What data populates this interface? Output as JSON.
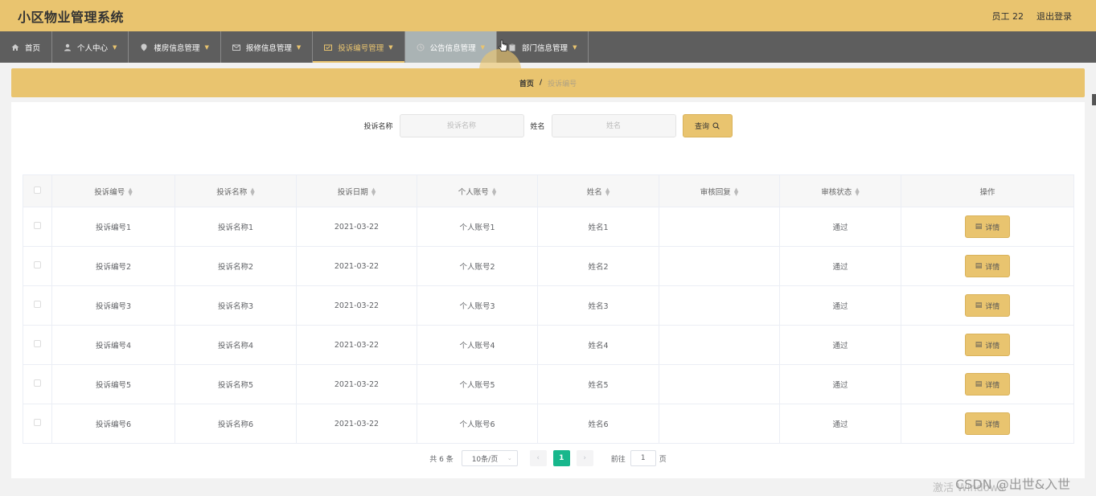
{
  "header": {
    "title": "小区物业管理系统",
    "user": "员工 22",
    "logout": "退出登录"
  },
  "nav": {
    "items": [
      {
        "label": "首页",
        "icon": "home-icon",
        "has_caret": false
      },
      {
        "label": "个人中心",
        "icon": "person-icon",
        "has_caret": true
      },
      {
        "label": "楼房信息管理",
        "icon": "location-icon",
        "has_caret": true
      },
      {
        "label": "报修信息管理",
        "icon": "mail-icon",
        "has_caret": true
      },
      {
        "label": "投诉编号管理",
        "icon": "ticket-icon",
        "has_caret": true,
        "active": true
      },
      {
        "label": "公告信息管理",
        "icon": "clock-icon",
        "has_caret": true,
        "hovered": true
      },
      {
        "label": "部门信息管理",
        "icon": "clipboard-icon",
        "has_caret": true
      }
    ],
    "caret": "▼"
  },
  "breadcrumb": {
    "home": "首页",
    "separator": "/",
    "current": "投诉编号"
  },
  "search": {
    "name_label": "投诉名称",
    "name_placeholder": "投诉名称",
    "person_label": "姓名",
    "person_placeholder": "姓名",
    "query_label": "查询"
  },
  "table": {
    "columns": [
      "投诉编号",
      "投诉名称",
      "投诉日期",
      "个人账号",
      "姓名",
      "审核回复",
      "审核状态",
      "操作"
    ],
    "rows": [
      {
        "code": "投诉编号1",
        "name": "投诉名称1",
        "date": "2021-03-22",
        "account": "个人账号1",
        "person": "姓名1",
        "reply": "",
        "status": "通过",
        "action": "详情"
      },
      {
        "code": "投诉编号2",
        "name": "投诉名称2",
        "date": "2021-03-22",
        "account": "个人账号2",
        "person": "姓名2",
        "reply": "",
        "status": "通过",
        "action": "详情"
      },
      {
        "code": "投诉编号3",
        "name": "投诉名称3",
        "date": "2021-03-22",
        "account": "个人账号3",
        "person": "姓名3",
        "reply": "",
        "status": "通过",
        "action": "详情"
      },
      {
        "code": "投诉编号4",
        "name": "投诉名称4",
        "date": "2021-03-22",
        "account": "个人账号4",
        "person": "姓名4",
        "reply": "",
        "status": "通过",
        "action": "详情"
      },
      {
        "code": "投诉编号5",
        "name": "投诉名称5",
        "date": "2021-03-22",
        "account": "个人账号5",
        "person": "姓名5",
        "reply": "",
        "status": "通过",
        "action": "详情"
      },
      {
        "code": "投诉编号6",
        "name": "投诉名称6",
        "date": "2021-03-22",
        "account": "个人账号6",
        "person": "姓名6",
        "reply": "",
        "status": "通过",
        "action": "详情"
      }
    ]
  },
  "pagination": {
    "total": "共 6 条",
    "page_size": "10条/页",
    "current_page": "1",
    "goto_label": "前往",
    "goto_value": "1",
    "page_suffix": "页"
  },
  "overlay": {
    "csdn": "CSDN @出世&入世",
    "watermark": "激活 Windows"
  },
  "colors": {
    "accent": "#e9c46f",
    "nav_bg": "#5e5e5e",
    "page_active": "#18b78c"
  }
}
